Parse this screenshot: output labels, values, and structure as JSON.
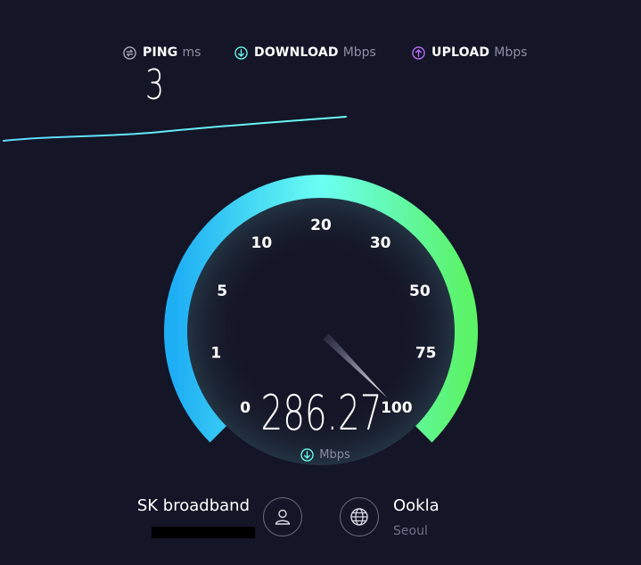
{
  "header": {
    "ping": {
      "label": "PING",
      "unit": "ms",
      "icon": "ping-icon",
      "icon_color": "#b0b2c3"
    },
    "download": {
      "label": "DOWNLOAD",
      "unit": "Mbps",
      "icon": "download-icon",
      "icon_color": "#6afff3"
    },
    "upload": {
      "label": "UPLOAD",
      "unit": "Mbps",
      "icon": "upload-icon",
      "icon_color": "#bf71ff"
    }
  },
  "ping_value": "3",
  "gauge": {
    "scale_labels": [
      "0",
      "1",
      "5",
      "10",
      "20",
      "30",
      "50",
      "75",
      "100"
    ],
    "current_speed": "286.27",
    "speed_unit": "Mbps",
    "needle_value": 100,
    "colors": {
      "start": "#23b4f5",
      "mid": "#6afff3",
      "end": "#5bf367"
    }
  },
  "isp": {
    "name": "SK broadband",
    "ip_redacted": true
  },
  "server": {
    "name": "Ookla",
    "location": "Seoul"
  }
}
